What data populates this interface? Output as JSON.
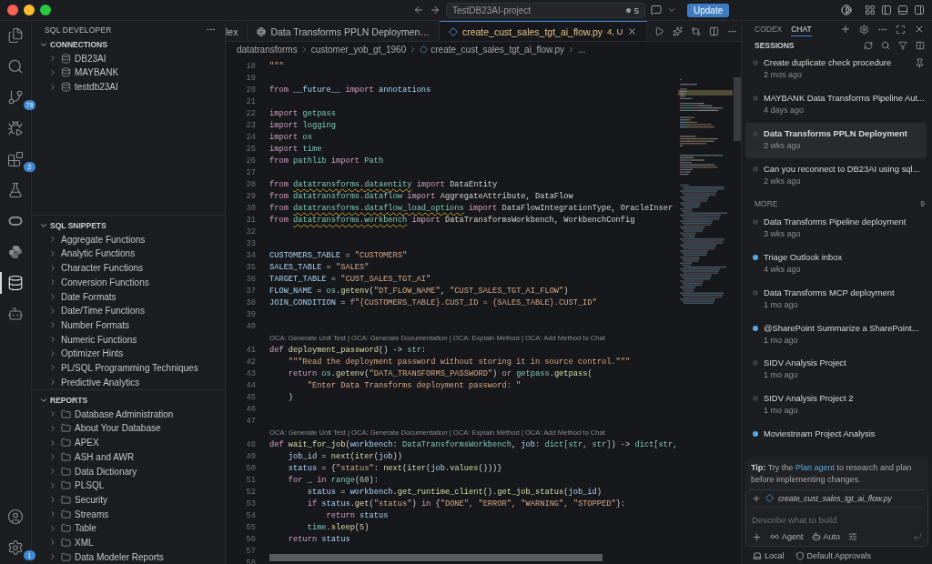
{
  "titlebar": {
    "project": "TestDB23AI-project",
    "changes": "5",
    "update": "Update"
  },
  "activity_bar": {
    "top": [
      {
        "kind": "files",
        "selected": false
      },
      {
        "kind": "search",
        "selected": false
      },
      {
        "kind": "source-control",
        "selected": false,
        "badge": "79"
      },
      {
        "kind": "run-debug",
        "selected": false
      },
      {
        "kind": "extensions",
        "selected": false,
        "badge": "2"
      },
      {
        "kind": "testing",
        "selected": false
      },
      {
        "kind": "oracle",
        "selected": false
      },
      {
        "kind": "python",
        "selected": false
      },
      {
        "kind": "sql-developer",
        "selected": true
      },
      {
        "kind": "robot",
        "selected": false
      }
    ],
    "bottom": [
      {
        "kind": "account",
        "selected": false
      },
      {
        "kind": "settings",
        "selected": false,
        "badge": "1"
      }
    ]
  },
  "sidebar": {
    "title": "SQL DEVELOPER",
    "sections": [
      {
        "title": "CONNECTIONS",
        "expanded": true,
        "items": [
          {
            "label": "DB23AI",
            "kind": "database",
            "expanded": false
          },
          {
            "label": "MAYBANK",
            "kind": "database",
            "expanded": false
          },
          {
            "label": "testdb23AI",
            "kind": "database",
            "expanded": false
          }
        ]
      },
      {
        "title": "SQL SNIPPETS",
        "expanded": true,
        "items": [
          {
            "label": "Aggregate Functions",
            "kind": "snippet",
            "expanded": false
          },
          {
            "label": "Analytic Functions",
            "kind": "snippet",
            "expanded": false
          },
          {
            "label": "Character Functions",
            "kind": "snippet",
            "expanded": false
          },
          {
            "label": "Conversion Functions",
            "kind": "snippet",
            "expanded": false
          },
          {
            "label": "Date Formats",
            "kind": "snippet",
            "expanded": false
          },
          {
            "label": "Date/Time Functions",
            "kind": "snippet",
            "expanded": false
          },
          {
            "label": "Number Formats",
            "kind": "snippet",
            "expanded": false
          },
          {
            "label": "Numeric Functions",
            "kind": "snippet",
            "expanded": false
          },
          {
            "label": "Optimizer Hints",
            "kind": "snippet",
            "expanded": false
          },
          {
            "label": "PL/SQL Programming Techniques",
            "kind": "snippet",
            "expanded": false
          },
          {
            "label": "Predictive Analytics",
            "kind": "snippet",
            "expanded": false
          }
        ]
      },
      {
        "title": "REPORTS",
        "expanded": true,
        "items": [
          {
            "label": "Database Administration",
            "kind": "folder",
            "expanded": false
          },
          {
            "label": "About Your Database",
            "kind": "folder",
            "expanded": false
          },
          {
            "label": "APEX",
            "kind": "folder",
            "expanded": false
          },
          {
            "label": "ASH and AWR",
            "kind": "folder",
            "expanded": false
          },
          {
            "label": "Data Dictionary",
            "kind": "folder",
            "expanded": false
          },
          {
            "label": "PLSQL",
            "kind": "folder",
            "expanded": false
          },
          {
            "label": "Security",
            "kind": "folder",
            "expanded": false
          },
          {
            "label": "Streams",
            "kind": "folder",
            "expanded": false
          },
          {
            "label": "Table",
            "kind": "folder",
            "expanded": false
          },
          {
            "label": "XML",
            "kind": "folder",
            "expanded": false
          },
          {
            "label": "Data Modeler Reports",
            "kind": "folder",
            "expanded": false
          }
        ]
      }
    ]
  },
  "editor": {
    "tabs": [
      {
        "label": "lex",
        "kind": "plain",
        "selected": false
      },
      {
        "label": "Data Transforms PPLN Deploymen…",
        "kind": "chat",
        "selected": false
      },
      {
        "label": "create_cust_sales_tgt_ai_flow.py",
        "kind": "python",
        "selected": true,
        "status": "4, U"
      }
    ],
    "breadcrumb": [
      {
        "label": "datatransforms",
        "kind": "folder"
      },
      {
        "label": "customer_yob_gt_1960",
        "kind": "folder"
      },
      {
        "label": "create_cust_sales_tgt_ai_flow.py",
        "kind": "file"
      },
      {
        "label": "...",
        "kind": "more"
      }
    ],
    "lines": [
      {
        "kind": "code",
        "n": "18",
        "tokens": [
          {
            "kind": "string",
            "text": "\"\"\""
          }
        ]
      },
      {
        "kind": "code",
        "n": "19"
      },
      {
        "kind": "code",
        "n": "20",
        "tokens": [
          {
            "kind": "keyword",
            "text": "from "
          },
          {
            "kind": "variable",
            "text": "__future__ "
          },
          {
            "kind": "keyword",
            "text": "import "
          },
          {
            "kind": "variable",
            "text": "annotations"
          }
        ]
      },
      {
        "kind": "code",
        "n": "21"
      },
      {
        "kind": "code",
        "n": "22",
        "tokens": [
          {
            "kind": "keyword",
            "text": "import "
          },
          {
            "kind": "type",
            "text": "getpass"
          }
        ]
      },
      {
        "kind": "code",
        "n": "23",
        "tokens": [
          {
            "kind": "keyword",
            "text": "import "
          },
          {
            "kind": "type",
            "text": "logging"
          }
        ]
      },
      {
        "kind": "code",
        "n": "24",
        "tokens": [
          {
            "kind": "keyword",
            "text": "import "
          },
          {
            "kind": "type",
            "text": "os"
          }
        ]
      },
      {
        "kind": "code",
        "n": "25",
        "tokens": [
          {
            "kind": "keyword",
            "text": "import "
          },
          {
            "kind": "type",
            "text": "time"
          }
        ]
      },
      {
        "kind": "code",
        "n": "26",
        "tokens": [
          {
            "kind": "keyword",
            "text": "from "
          },
          {
            "kind": "type",
            "text": "pathlib "
          },
          {
            "kind": "keyword",
            "text": "import "
          },
          {
            "kind": "type",
            "text": "Path"
          }
        ]
      },
      {
        "kind": "code",
        "n": "27"
      },
      {
        "kind": "code",
        "n": "28",
        "tokens": [
          {
            "kind": "keyword",
            "text": "from "
          },
          {
            "kind": "warning",
            "text": "datatransforms.dataentity"
          },
          {
            "kind": "keyword",
            "text": " import "
          },
          {
            "kind": "plain",
            "text": "DataEntity"
          }
        ]
      },
      {
        "kind": "code",
        "n": "29",
        "tokens": [
          {
            "kind": "keyword",
            "text": "from "
          },
          {
            "kind": "type",
            "text": "datatransforms.dataflow"
          },
          {
            "kind": "keyword",
            "text": " import "
          },
          {
            "kind": "plain",
            "text": "AggregateAttribute, DataFlow"
          }
        ]
      },
      {
        "kind": "code",
        "n": "30",
        "tokens": [
          {
            "kind": "keyword",
            "text": "from "
          },
          {
            "kind": "warning",
            "text": "datatransforms.dataflow_load_options"
          },
          {
            "kind": "keyword",
            "text": " import "
          },
          {
            "kind": "plain",
            "text": "DataFlowIntegrationType, OracleInser"
          }
        ]
      },
      {
        "kind": "code",
        "n": "31",
        "tokens": [
          {
            "kind": "keyword",
            "text": "from "
          },
          {
            "kind": "warning",
            "text": "datatransforms.workbench"
          },
          {
            "kind": "keyword",
            "text": " import "
          },
          {
            "kind": "plain",
            "text": "DataTransformsWorkbench, WorkbenchConfig"
          }
        ]
      },
      {
        "kind": "code",
        "n": "32"
      },
      {
        "kind": "code",
        "n": "33"
      },
      {
        "kind": "code",
        "n": "34",
        "tokens": [
          {
            "kind": "variable",
            "text": "CUSTOMERS_TABLE"
          },
          {
            "kind": "plain",
            "text": " = "
          },
          {
            "kind": "string",
            "text": "\"CUSTOMERS\""
          }
        ]
      },
      {
        "kind": "code",
        "n": "35",
        "tokens": [
          {
            "kind": "variable",
            "text": "SALES_TABLE"
          },
          {
            "kind": "plain",
            "text": " = "
          },
          {
            "kind": "string",
            "text": "\"SALES\""
          }
        ]
      },
      {
        "kind": "code",
        "n": "36",
        "tokens": [
          {
            "kind": "variable",
            "text": "TARGET_TABLE"
          },
          {
            "kind": "plain",
            "text": " = "
          },
          {
            "kind": "string",
            "text": "\"CUST_SALES_TGT_AI\""
          }
        ]
      },
      {
        "kind": "code",
        "n": "37",
        "tokens": [
          {
            "kind": "variable",
            "text": "FLOW_NAME"
          },
          {
            "kind": "plain",
            "text": " = "
          },
          {
            "kind": "type",
            "text": "os"
          },
          {
            "kind": "plain",
            "text": "."
          },
          {
            "kind": "function",
            "text": "getenv"
          },
          {
            "kind": "plain",
            "text": "("
          },
          {
            "kind": "string",
            "text": "\"DT_FLOW_NAME\""
          },
          {
            "kind": "plain",
            "text": ", "
          },
          {
            "kind": "string",
            "text": "\"CUST_SALES_TGT_AI_FLOW\""
          },
          {
            "kind": "plain",
            "text": ")"
          }
        ]
      },
      {
        "kind": "code",
        "n": "38",
        "tokens": [
          {
            "kind": "variable",
            "text": "JOIN_CONDITION"
          },
          {
            "kind": "plain",
            "text": " = "
          },
          {
            "kind": "keyword",
            "text": "f"
          },
          {
            "kind": "string",
            "text": "\"{CUSTOMERS_TABLE}.CUST_ID = {SALES_TABLE}.CUST_ID\""
          }
        ]
      },
      {
        "kind": "code",
        "n": "39"
      },
      {
        "kind": "code",
        "n": "40"
      },
      {
        "kind": "lens",
        "text": "OCA: Generate Unit Test | OCA: Generate Documentation | OCA: Explain Method | OCA: Add Method to Chat"
      },
      {
        "kind": "code",
        "n": "41",
        "tokens": [
          {
            "kind": "keyword",
            "text": "def "
          },
          {
            "kind": "function",
            "text": "deployment_password"
          },
          {
            "kind": "plain",
            "text": "() -> "
          },
          {
            "kind": "type",
            "text": "str"
          },
          {
            "kind": "plain",
            "text": ":"
          }
        ]
      },
      {
        "kind": "code",
        "n": "42",
        "tokens": [
          {
            "kind": "string",
            "text": "    \"\"\"Read the deployment password without storing it in source control.\"\"\""
          }
        ]
      },
      {
        "kind": "code",
        "n": "43",
        "tokens": [
          {
            "kind": "keyword",
            "text": "    return "
          },
          {
            "kind": "type",
            "text": "os"
          },
          {
            "kind": "plain",
            "text": "."
          },
          {
            "kind": "function",
            "text": "getenv"
          },
          {
            "kind": "plain",
            "text": "("
          },
          {
            "kind": "string",
            "text": "\"DATA_TRANSFORMS_PASSWORD\""
          },
          {
            "kind": "plain",
            "text": ") "
          },
          {
            "kind": "keyword",
            "text": "or "
          },
          {
            "kind": "type",
            "text": "getpass"
          },
          {
            "kind": "plain",
            "text": "."
          },
          {
            "kind": "function",
            "text": "getpass"
          },
          {
            "kind": "plain",
            "text": "("
          }
        ]
      },
      {
        "kind": "code",
        "n": "44",
        "tokens": [
          {
            "kind": "string",
            "text": "        \"Enter Data Transforms deployment password: \""
          }
        ]
      },
      {
        "kind": "code",
        "n": "45",
        "tokens": [
          {
            "kind": "plain",
            "text": "    )"
          }
        ]
      },
      {
        "kind": "code",
        "n": "46"
      },
      {
        "kind": "code",
        "n": "47"
      },
      {
        "kind": "lens",
        "text": "OCA: Generate Unit Test | OCA: Generate Documentation | OCA: Explain Method | OCA: Add Method to Chat"
      },
      {
        "kind": "code",
        "n": "48",
        "tokens": [
          {
            "kind": "keyword",
            "text": "def "
          },
          {
            "kind": "function",
            "text": "wait_for_job"
          },
          {
            "kind": "plain",
            "text": "("
          },
          {
            "kind": "variable",
            "text": "workbench"
          },
          {
            "kind": "plain",
            "text": ": "
          },
          {
            "kind": "type",
            "text": "DataTransformsWorkbench"
          },
          {
            "kind": "plain",
            "text": ", "
          },
          {
            "kind": "variable",
            "text": "job"
          },
          {
            "kind": "plain",
            "text": ": "
          },
          {
            "kind": "type",
            "text": "dict[str, str]"
          },
          {
            "kind": "plain",
            "text": ") -> "
          },
          {
            "kind": "type",
            "text": "dict[str,"
          }
        ]
      },
      {
        "kind": "code",
        "n": "49",
        "tokens": [
          {
            "kind": "variable",
            "text": "    job_id"
          },
          {
            "kind": "plain",
            "text": " = "
          },
          {
            "kind": "function",
            "text": "next"
          },
          {
            "kind": "plain",
            "text": "("
          },
          {
            "kind": "function",
            "text": "iter"
          },
          {
            "kind": "plain",
            "text": "("
          },
          {
            "kind": "variable",
            "text": "job"
          },
          {
            "kind": "plain",
            "text": "))"
          }
        ]
      },
      {
        "kind": "code",
        "n": "50",
        "tokens": [
          {
            "kind": "variable",
            "text": "    status"
          },
          {
            "kind": "plain",
            "text": " = {"
          },
          {
            "kind": "string",
            "text": "\"status\""
          },
          {
            "kind": "plain",
            "text": ": "
          },
          {
            "kind": "function",
            "text": "next"
          },
          {
            "kind": "plain",
            "text": "("
          },
          {
            "kind": "function",
            "text": "iter"
          },
          {
            "kind": "plain",
            "text": "("
          },
          {
            "kind": "variable",
            "text": "job"
          },
          {
            "kind": "plain",
            "text": "."
          },
          {
            "kind": "function",
            "text": "values"
          },
          {
            "kind": "plain",
            "text": "()))}"
          }
        ]
      },
      {
        "kind": "code",
        "n": "51",
        "tokens": [
          {
            "kind": "keyword",
            "text": "    for "
          },
          {
            "kind": "variable",
            "text": "_ "
          },
          {
            "kind": "keyword",
            "text": "in "
          },
          {
            "kind": "type",
            "text": "range"
          },
          {
            "kind": "plain",
            "text": "("
          },
          {
            "kind": "number",
            "text": "60"
          },
          {
            "kind": "plain",
            "text": "):"
          }
        ]
      },
      {
        "kind": "code",
        "n": "52",
        "tokens": [
          {
            "kind": "variable",
            "text": "        status"
          },
          {
            "kind": "plain",
            "text": " = "
          },
          {
            "kind": "variable",
            "text": "workbench"
          },
          {
            "kind": "plain",
            "text": "."
          },
          {
            "kind": "function",
            "text": "get_runtime_client"
          },
          {
            "kind": "plain",
            "text": "()."
          },
          {
            "kind": "function",
            "text": "get_job_status"
          },
          {
            "kind": "plain",
            "text": "("
          },
          {
            "kind": "variable",
            "text": "job_id"
          },
          {
            "kind": "plain",
            "text": ")"
          }
        ]
      },
      {
        "kind": "code",
        "n": "53",
        "tokens": [
          {
            "kind": "keyword",
            "text": "        if "
          },
          {
            "kind": "variable",
            "text": "status"
          },
          {
            "kind": "plain",
            "text": "."
          },
          {
            "kind": "function",
            "text": "get"
          },
          {
            "kind": "plain",
            "text": "("
          },
          {
            "kind": "string",
            "text": "\"status\""
          },
          {
            "kind": "plain",
            "text": ") "
          },
          {
            "kind": "keyword",
            "text": "in "
          },
          {
            "kind": "plain",
            "text": "{"
          },
          {
            "kind": "string",
            "text": "\"DONE\", \"ERROR\", \"WARNING\", \"STOPPED\""
          },
          {
            "kind": "plain",
            "text": "}:"
          }
        ]
      },
      {
        "kind": "code",
        "n": "54",
        "tokens": [
          {
            "kind": "keyword",
            "text": "            return "
          },
          {
            "kind": "variable",
            "text": "status"
          }
        ]
      },
      {
        "kind": "code",
        "n": "55",
        "tokens": [
          {
            "kind": "type",
            "text": "        time"
          },
          {
            "kind": "plain",
            "text": "."
          },
          {
            "kind": "function",
            "text": "sleep"
          },
          {
            "kind": "plain",
            "text": "("
          },
          {
            "kind": "number",
            "text": "5"
          },
          {
            "kind": "plain",
            "text": ")"
          }
        ]
      },
      {
        "kind": "code",
        "n": "56",
        "tokens": [
          {
            "kind": "keyword",
            "text": "    return "
          },
          {
            "kind": "variable",
            "text": "status"
          }
        ]
      },
      {
        "kind": "code",
        "n": "57"
      },
      {
        "kind": "code",
        "n": "58"
      }
    ]
  },
  "chat": {
    "tabs": [
      {
        "label": "CODEX",
        "selected": false
      },
      {
        "label": "CHAT",
        "selected": true
      }
    ],
    "sessions_title": "SESSIONS",
    "sessions": [
      {
        "title": "Create duplicate check procedure",
        "time": "2 mos ago",
        "selected": false,
        "unread": false,
        "pinned": true
      },
      {
        "title": "MAYBANK Data Transforms Pipeline Aut...",
        "time": "4 days ago",
        "selected": false,
        "unread": false,
        "pinned": false
      },
      {
        "title": "Data Transforms PPLN Deployment",
        "time": "2 wks ago",
        "selected": true,
        "unread": false,
        "pinned": false
      },
      {
        "title": "Can you reconnect to DB23AI using sql...",
        "time": "2 wks ago",
        "selected": false,
        "unread": false,
        "pinned": false
      }
    ],
    "more": {
      "title": "MORE",
      "count": "9"
    },
    "more_sessions": [
      {
        "title": "Data Transforms Pipeline deployment",
        "time": "3 wks ago",
        "selected": false,
        "unread": false,
        "pinned": false
      },
      {
        "title": "Triage Outlook inbox",
        "time": "4 wks ago",
        "selected": false,
        "unread": true,
        "pinned": false
      },
      {
        "title": "Data Transforms MCP deployment",
        "time": "1 mo ago",
        "selected": false,
        "unread": false,
        "pinned": false
      },
      {
        "title": "@SharePoint Summarize a SharePoint...",
        "time": "1 mo ago",
        "selected": false,
        "unread": true,
        "pinned": false
      },
      {
        "title": "SIDV Analysis Project",
        "time": "1 mo ago",
        "selected": false,
        "unread": false,
        "pinned": false
      },
      {
        "title": "SIDV Analysis Project 2",
        "time": "1 mo ago",
        "selected": false,
        "unread": false,
        "pinned": false
      },
      {
        "title": "Moviestream Project Analysis",
        "selected": false,
        "unread": true,
        "pinned": false
      }
    ],
    "tip": {
      "lead": "Tip:",
      "before": "Try the ",
      "link": "Plan agent",
      "after": " to research and plan before implementing changes."
    },
    "composer": {
      "attachment": "create_cust_sales_tgt_ai_flow.py",
      "placeholder": "Describe what to build",
      "mode": "Agent",
      "approval": "Auto"
    },
    "footer": {
      "location": "Local",
      "approvals": "Default Approvals"
    }
  }
}
